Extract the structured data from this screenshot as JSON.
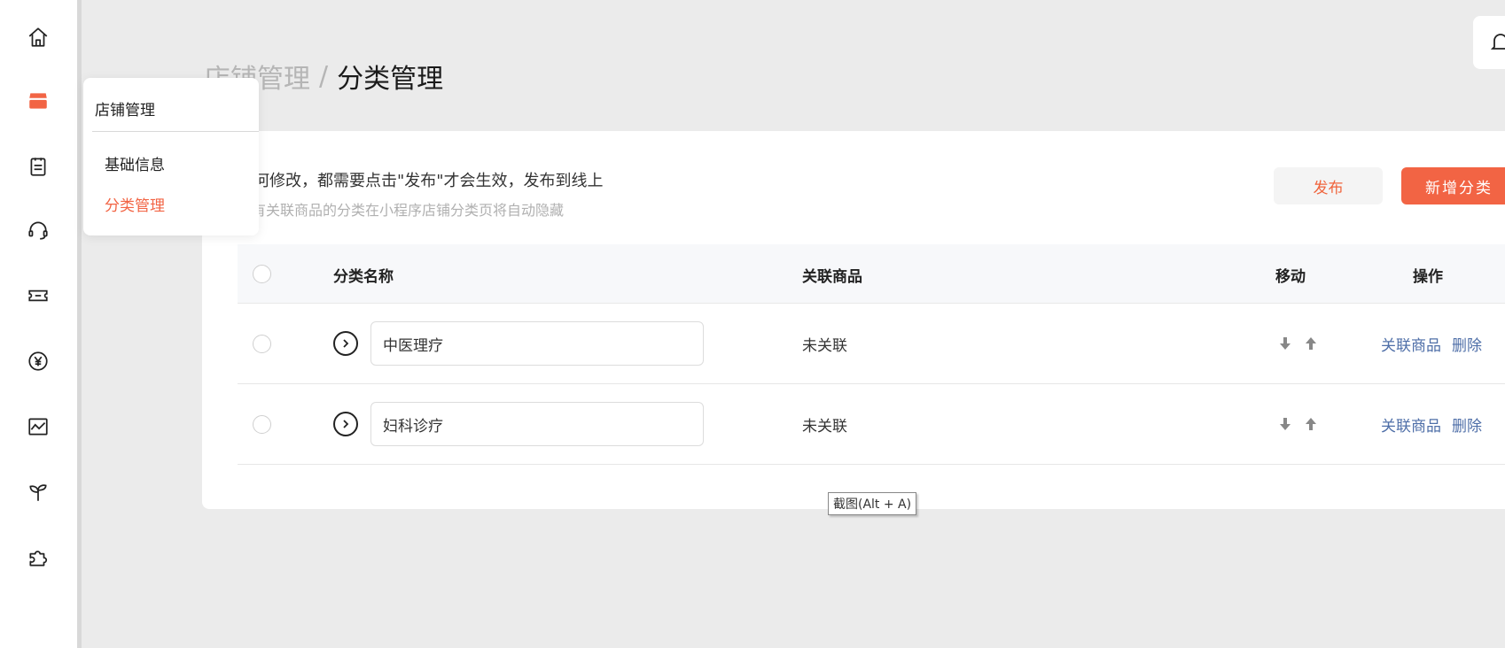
{
  "sidebar": {
    "items": [
      {
        "icon": "home-icon"
      },
      {
        "icon": "store-icon",
        "active": true,
        "color": "#f26444"
      },
      {
        "icon": "clipboard-icon"
      },
      {
        "icon": "headset-icon"
      },
      {
        "icon": "ticket-icon"
      },
      {
        "icon": "yen-icon"
      },
      {
        "icon": "chart-icon"
      },
      {
        "icon": "sprout-icon"
      },
      {
        "icon": "puzzle-icon"
      }
    ]
  },
  "breadcrumb": {
    "parent": "店铺管理",
    "separator": "/",
    "current": "分类管理"
  },
  "header": {
    "bell_icon": "bell-icon"
  },
  "flyout": {
    "title": "店铺管理",
    "items": [
      {
        "label": "基础信息",
        "active": false
      },
      {
        "label": "分类管理",
        "active": true
      }
    ]
  },
  "notice": {
    "line1": "任何修改，都需要点击\"发布\"才会生效，发布到线上",
    "line2": "没有关联商品的分类在小程序店铺分类页将自动隐藏"
  },
  "buttons": {
    "publish": "发布",
    "add": "新增分类"
  },
  "table": {
    "headers": {
      "name": "分类名称",
      "linked": "关联商品",
      "move": "移动",
      "action": "操作"
    },
    "rows": [
      {
        "name": "中医理疗",
        "linked": "未关联",
        "action_link": "关联商品",
        "action_delete": "删除"
      },
      {
        "name": "妇科诊疗",
        "linked": "未关联",
        "action_link": "关联商品",
        "action_delete": "删除"
      }
    ]
  },
  "tooltip": "截图(Alt + A)",
  "colors": {
    "accent": "#f26444",
    "link": "#4f6fa8",
    "background": "#ebebeb"
  }
}
